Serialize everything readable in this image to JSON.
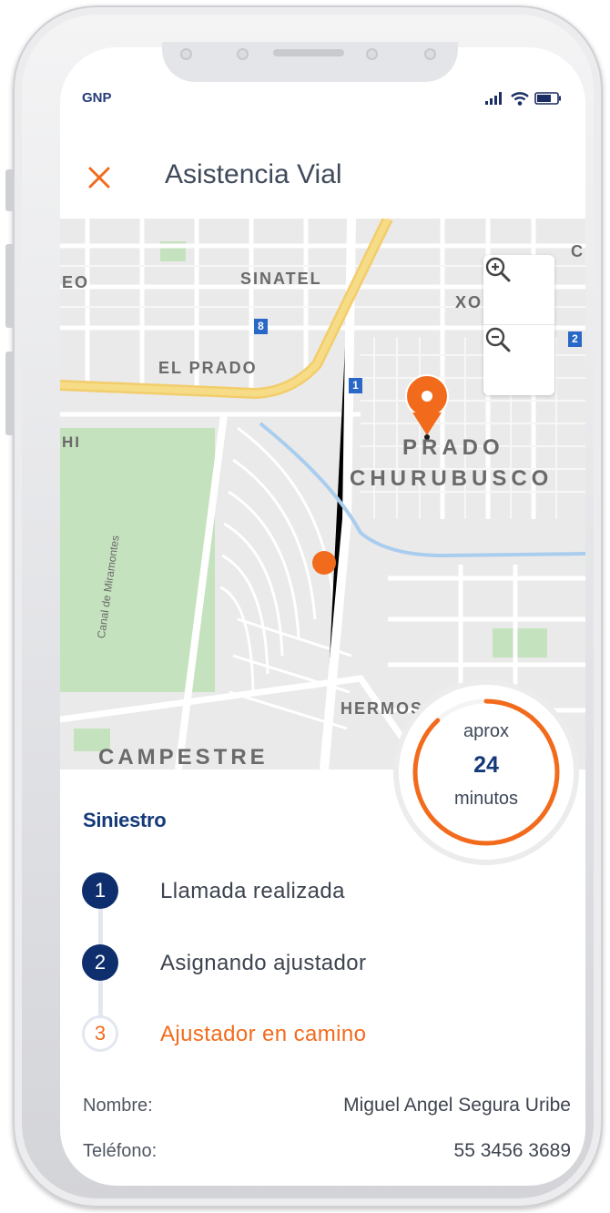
{
  "status_bar": {
    "carrier": "GNP"
  },
  "header": {
    "title": "Asistencia Vial"
  },
  "map": {
    "labels": [
      "SINATEL",
      "EL PRADO",
      "PRADO",
      "CHURUBUSCO",
      "CAMPESTRE",
      "HERMOS",
      "Canal de Miramontes",
      "XO",
      "EO",
      "HI",
      "C"
    ],
    "route_badges": [
      "8",
      "1",
      "2"
    ]
  },
  "eta": {
    "prefix": "aprox",
    "value": "24",
    "unit": "minutos",
    "progress": 0.88
  },
  "section": {
    "title": "Siniestro"
  },
  "steps": [
    {
      "number": "1",
      "label": "Llamada realizada",
      "state": "done"
    },
    {
      "number": "2",
      "label": "Asignando ajustador",
      "state": "done"
    },
    {
      "number": "3",
      "label": "Ajustador en camino",
      "state": "active"
    }
  ],
  "info": {
    "name_label": "Nombre:",
    "name_value": "Miguel Angel Segura Uribe",
    "phone_label": "Teléfono:",
    "phone_value": "55 3456 3689"
  },
  "colors": {
    "accent": "#f26b1d",
    "primary": "#153a7a"
  }
}
